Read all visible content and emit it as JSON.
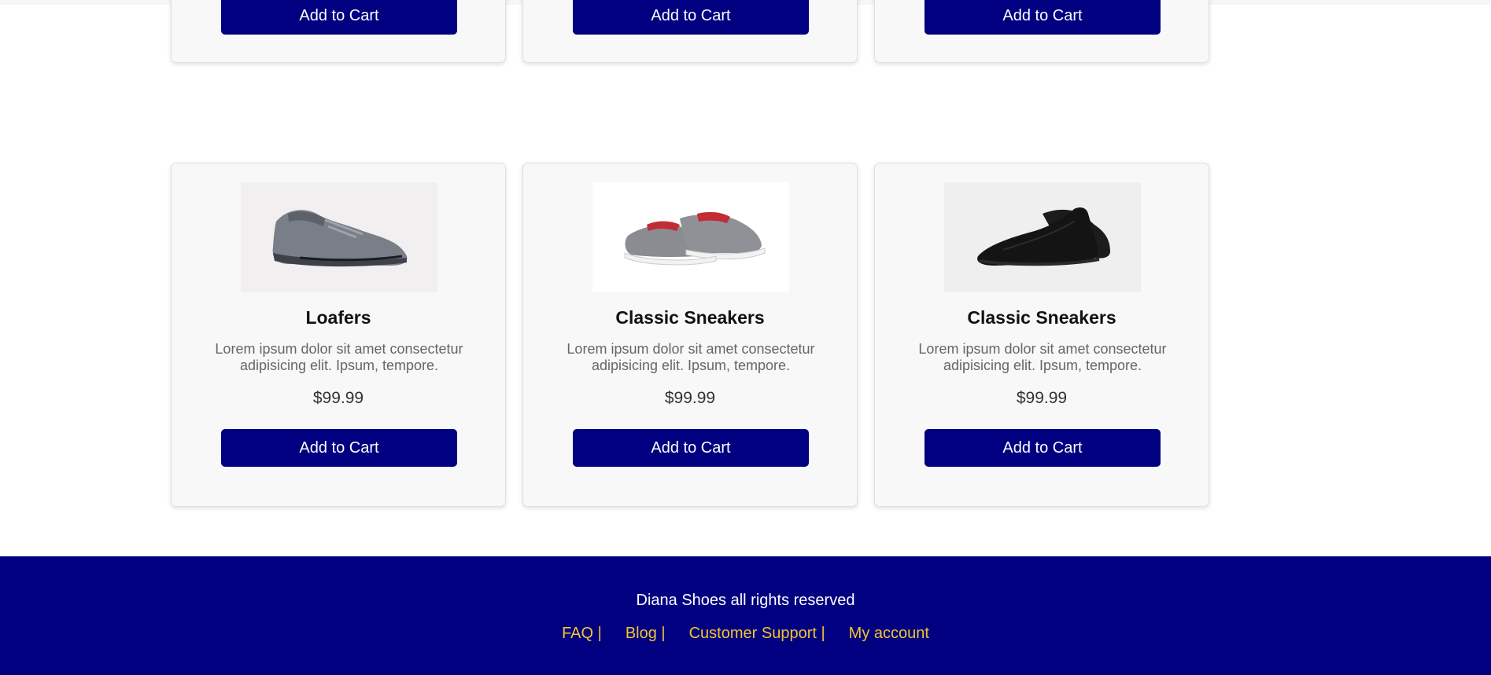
{
  "colors": {
    "accent": "#000080",
    "link": "#f4c430",
    "card_background": "#f8f8f8"
  },
  "partial_row": [
    {
      "button_label": "Add to Cart"
    },
    {
      "button_label": "Add to Cart"
    },
    {
      "button_label": "Add to Cart"
    }
  ],
  "products": [
    {
      "image_icon": "grey-sneaker-image",
      "title": "Loafers",
      "description": "Lorem ipsum dolor sit amet consectetur adipisicing elit. Ipsum, tempore.",
      "price": "$99.99",
      "button_label": "Add to Cart"
    },
    {
      "image_icon": "slip-on-sneaker-image",
      "title": "Classic Sneakers",
      "description": "Lorem ipsum dolor sit amet consectetur adipisicing elit. Ipsum, tempore.",
      "price": "$99.99",
      "button_label": "Add to Cart"
    },
    {
      "image_icon": "black-slip-on-image",
      "title": "Classic Sneakers",
      "description": "Lorem ipsum dolor sit amet consectetur adipisicing elit. Ipsum, tempore.",
      "price": "$99.99",
      "button_label": "Add to Cart"
    }
  ],
  "footer": {
    "copyright": "Diana Shoes all rights reserved",
    "links": [
      "FAQ |",
      "Blog |",
      "Customer Support |",
      "My account"
    ]
  }
}
